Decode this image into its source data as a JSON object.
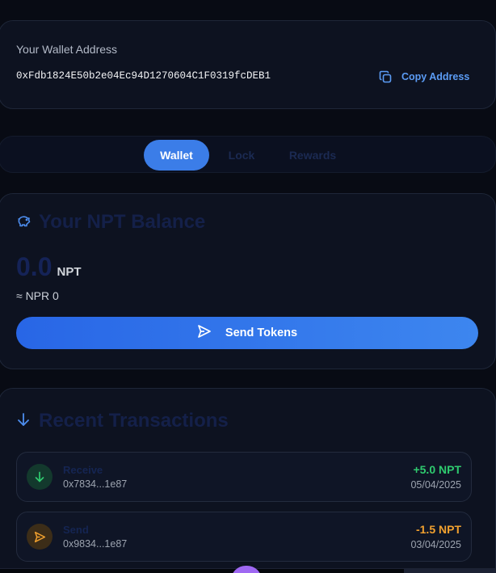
{
  "wallet_address": {
    "title": "Your Wallet Address",
    "address": "0xFdb1824E50b2e04Ec94D1270604C1F0319fcDEB1",
    "copy_label": "Copy Address"
  },
  "tabs": [
    {
      "label": "Wallet",
      "active": true
    },
    {
      "label": "Lock",
      "active": false
    },
    {
      "label": "Rewards",
      "active": false
    }
  ],
  "balance": {
    "title": "Your NPT Balance",
    "amount": "0.0",
    "unit": "NPT",
    "fiat": "≈ NPR 0",
    "send_label": "Send Tokens",
    "icon": "piggy-bank-icon"
  },
  "transactions": {
    "title": "Recent Transactions",
    "icon": "arrow-down-icon",
    "items": [
      {
        "type": "Receive",
        "address": "0x7834...1e87",
        "amount": "+5.0 NPT",
        "date": "05/04/2025",
        "color": "#2fcb6f",
        "icon": "arrow-down-icon"
      },
      {
        "type": "Send",
        "address": "0x9834...1e87",
        "amount": "-1.5 NPT",
        "date": "03/04/2025",
        "color": "#f2a12f",
        "icon": "send-icon"
      }
    ]
  },
  "colors": {
    "accent": "#3b7de8",
    "background": "#080b14",
    "positive": "#2fcb6f",
    "negative": "#f2a12f"
  }
}
